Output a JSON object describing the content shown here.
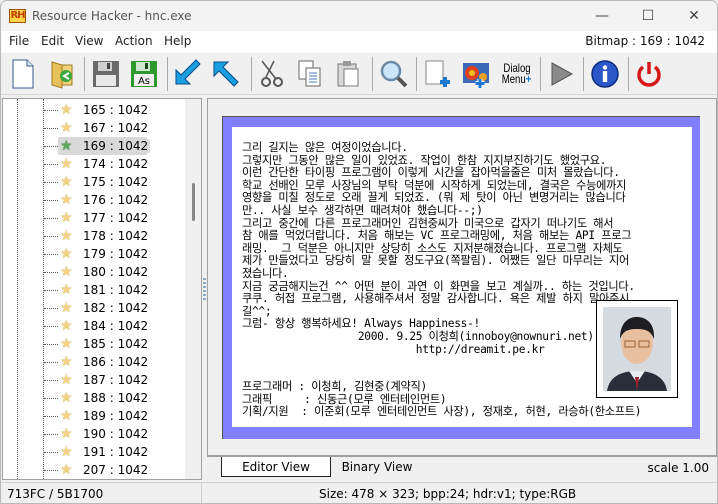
{
  "window": {
    "title": "Resource Hacker - hnc.exe",
    "logo_text": "RH",
    "controls": {
      "minimize": "—",
      "maximize": "☐",
      "close": "✕"
    }
  },
  "menu": {
    "items": [
      "File",
      "Edit",
      "View",
      "Action",
      "Help"
    ],
    "resource_label": "Bitmap : 169 : 1042"
  },
  "toolbar": {
    "buttons": [
      {
        "name": "new-file",
        "icon": "new-document-icon"
      },
      {
        "name": "open-file",
        "icon": "open-folder-icon"
      },
      {
        "name": "save",
        "icon": "save-floppy-icon"
      },
      {
        "name": "save-as",
        "icon": "save-as-floppy-icon",
        "label": "As"
      },
      {
        "name": "compile-script",
        "icon": "arrow-down-left-icon"
      },
      {
        "name": "export",
        "icon": "arrow-up-left-icon"
      },
      {
        "name": "cut",
        "icon": "scissors-icon"
      },
      {
        "name": "copy",
        "icon": "copy-icon"
      },
      {
        "name": "paste",
        "icon": "paste-icon"
      },
      {
        "name": "find",
        "icon": "magnifier-icon"
      },
      {
        "name": "add-blank-resource",
        "icon": "add-blank-icon"
      },
      {
        "name": "add-image-resource",
        "icon": "add-image-icon"
      },
      {
        "name": "dialog-menu",
        "icon": "dialog-menu-icon",
        "label_top": "Dialog",
        "label_bottom": "Menu"
      },
      {
        "name": "run",
        "icon": "play-icon"
      },
      {
        "name": "about",
        "icon": "info-icon"
      },
      {
        "name": "exit",
        "icon": "power-icon"
      }
    ]
  },
  "tree": {
    "selected": "169 : 1042",
    "items": [
      "165 : 1042",
      "167 : 1042",
      "169 : 1042",
      "174 : 1042",
      "175 : 1042",
      "176 : 1042",
      "177 : 1042",
      "178 : 1042",
      "179 : 1042",
      "180 : 1042",
      "181 : 1042",
      "182 : 1042",
      "184 : 1042",
      "185 : 1042",
      "186 : 1042",
      "187 : 1042",
      "188 : 1042",
      "189 : 1042",
      "190 : 1042",
      "191 : 1042",
      "207 : 1042"
    ]
  },
  "bitmap": {
    "lines": [
      "그리 길지는 않은 여정이었습니다.",
      "그렇지만 그동안 많은 일이 있었죠. 작업이 한참 지지부진하기도 했었구요.",
      "이런 간단한 타이핑 프로그램이 이렇게 시간을 잡아먹을줄은 미처 몰랐습니다.",
      "학교 선배인 모루 사장님의 부탁 덕분에 시작하게 되었는데, 결국은 수능에까지",
      "영향을 미칠 정도로 오래 끌게 되었죠. (뭐 제 탓이 아닌 변명거리는 많습니다",
      "만.. 사실 보수 생각하면 때려쳐야 했습니다--;)",
      "그리고 중간에 다른 프로그래머인 김현중씨가 미국으로 갑자기 떠나기도 해서",
      "참 애를 먹었더랍니다. 처음 해보는 VC 프로그래밍에, 처음 해보는 API 프로그",
      "래밍.  그 덕분은 아니지만 상당히 소스도 지저분해졌습니다. 프로그램 자체도",
      "제가 만들었다고 당당히 말 못할 정도구요(쪽팔림). 어쨌든 일단 마무리는 지어",
      "졌습니다.",
      "지금 궁금해지는건 ^^ 어떤 분이 과연 이 화면을 보고 계실까.. 하는 것입니다.",
      "쿠쿠. 허접 프로그램, 사용해주셔서 정말 감사합니다. 욕은 제발 하지 말아주시",
      "길^^;",
      "그럼- 항상 행복하세요! Always Happiness-!",
      "                  2000. 9.25 이청희(innoboy@nownuri.net)",
      "                           http://dreamit.pe.kr",
      "",
      "",
      "프로그래머 : 이청희, 김현중(계약직)",
      "그래픽     : 신동근(모루 엔터테인먼트)",
      "기획/지원  : 이준회(모루 엔터테인먼트 사장), 정재호, 허현, 라승하(한소프트)"
    ],
    "frame_color": "#8080ff"
  },
  "tabs": {
    "editor_view": "Editor View",
    "binary_view": "Binary View",
    "scale": "scale 1.00"
  },
  "status": {
    "offset": "713FC / 5B1700",
    "info": "Size: 478 × 323;  bpp:24;  hdr:v1;  type:RGB"
  }
}
